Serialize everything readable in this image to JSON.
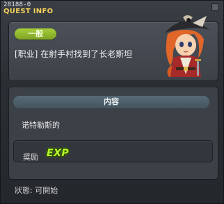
{
  "window": {
    "quest_id": "28188-0",
    "title": "QUEST INFO"
  },
  "quest": {
    "category": "一般",
    "name": "[职业] 在射手村找到了长老斯坦"
  },
  "content": {
    "header": "内容",
    "description": "诺特勒斯的"
  },
  "reward": {
    "label": "奨励",
    "exp_label": "EXP"
  },
  "status": {
    "text": "狀態: 可開始"
  },
  "colors": {
    "title": "#f5d25a",
    "category_pill": "#a6cf3a",
    "exp": "#b8ff2e"
  },
  "icons": {
    "portrait": "pirate-npc-portrait",
    "close": "close-icon"
  }
}
